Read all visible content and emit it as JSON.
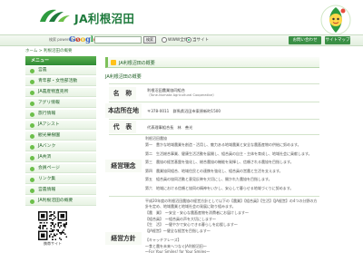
{
  "header": {
    "logo_text": "JA利根沼田",
    "brand_color": "#1e7a3c",
    "icons": [
      "ja-leaf-logo-icon",
      "mascot-icon"
    ]
  },
  "searchbar": {
    "powered_by": "検索 powered by",
    "google": [
      "G",
      "o",
      "o",
      "g",
      "l",
      "e"
    ],
    "google_colors": [
      "#3b63c6",
      "#d63b2b",
      "#f2b619",
      "#3b63c6",
      "#2a9a42",
      "#d63b2b"
    ],
    "input_value": "",
    "search_label": "検索",
    "option_web": "WWW全体",
    "option_site": "当サイト",
    "inquiry_label": "お問い合わせ",
    "sitemap_label": "サイトマップ"
  },
  "breadcrumb": "ホーム > 利根沼田の概要",
  "sidebar": {
    "menu_title": "メニュー",
    "items": [
      {
        "label": "営農"
      },
      {
        "label": "青年部・女性部活動"
      },
      {
        "label": "JA農産物直売所"
      },
      {
        "label": "アグリ情報"
      },
      {
        "label": "旅行情報"
      },
      {
        "label": "JAアシスト"
      },
      {
        "label": "観光果樹園"
      },
      {
        "label": "JAバンク"
      },
      {
        "label": "JA共済"
      },
      {
        "label": "会員ページ"
      },
      {
        "label": "リンク集"
      },
      {
        "label": "営農情報"
      },
      {
        "label": "JA利根沼田の概要"
      }
    ],
    "qr_caption": "携帯サイト"
  },
  "main": {
    "page_title": "JA利根沼田の概要",
    "section_title": "JA利根沼田の概要",
    "rows": [
      {
        "label": "名　称",
        "value": "利根沼田農業協同組合",
        "sub": "（Tone-Numata Agricultural Cooperative）"
      },
      {
        "label": "本店所在地",
        "value": "〒378-0011　群馬県沼田市東原新町1500"
      },
      {
        "label": "代　表",
        "value": "代表理事組合長　林　善光"
      }
    ],
    "philosophy_label": "経営理念",
    "philosophy_heading": "利根沼田農協",
    "philosophy_lines": [
      "第一　豊かな地域農業を創造・活用し、魅力ある地域農業と安全な農畜産物の供給に努めます。",
      "第二　生活総合事業、健康生活活動を展開し、組合員の自主・主体を育成し、地域社会に貢献します。",
      "第三　農協の経営基盤を強化し、総合農協の機能を発揮し、信頼される農協を目指します。",
      "第四　農業協同組合、地域住民との連携を強化し、組合員の営農と生活を支えます。",
      "第五　組合員の協同活動と意見反映を大切にし、開かれた農協を目指します。",
      "第六　地域における信頼と協同の精神をいかし、安心して暮らせる地域づくりに努めます。"
    ],
    "policy_label": "経営方針",
    "policy_lines": [
      "平成20年度の利根沼田農協の経営方針として以下の【農業】【組合員】【生活】【JA経営】の4つの分野の方針を定め、地域農業と地域社会の発展に取り組みます。",
      "【農　業】　〜安全・安心な農畜産物を消費者にお届けします〜",
      "【組合員】　〜組合員の声を大切にします〜",
      "【生　活】　〜健やかで安心できる暮らしを応援します〜",
      "【JA経営】〜健全な経営を目指します〜",
      "【キャッチフレーズ】",
      "〜食と農を未来へつなぐJA利根沼田〜",
      "〜For Your Smiles! for Your Smiles〜"
    ]
  },
  "colors": {
    "accent": "#3a8f45",
    "menu_green": "#2f8a35",
    "label_bg": "#f7faf4"
  }
}
